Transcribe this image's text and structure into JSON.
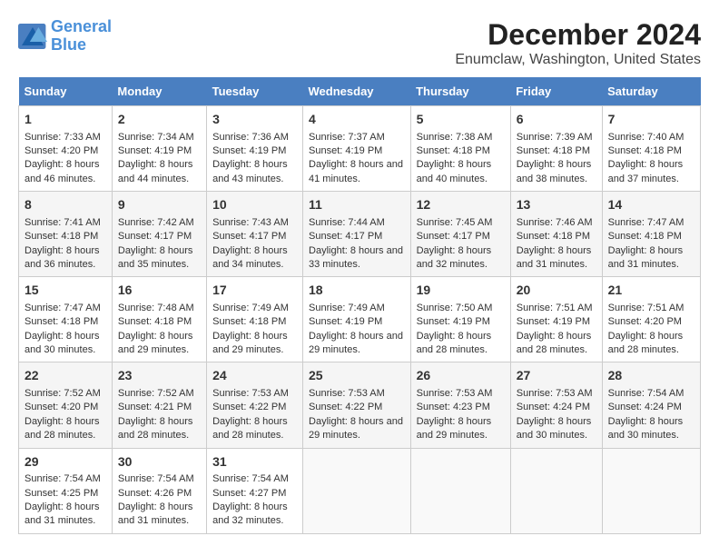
{
  "logo": {
    "line1": "General",
    "line2": "Blue"
  },
  "title": "December 2024",
  "subtitle": "Enumclaw, Washington, United States",
  "days_of_week": [
    "Sunday",
    "Monday",
    "Tuesday",
    "Wednesday",
    "Thursday",
    "Friday",
    "Saturday"
  ],
  "weeks": [
    [
      {
        "day": "1",
        "sunrise": "7:33 AM",
        "sunset": "4:20 PM",
        "daylight": "8 hours and 46 minutes."
      },
      {
        "day": "2",
        "sunrise": "7:34 AM",
        "sunset": "4:19 PM",
        "daylight": "8 hours and 44 minutes."
      },
      {
        "day": "3",
        "sunrise": "7:36 AM",
        "sunset": "4:19 PM",
        "daylight": "8 hours and 43 minutes."
      },
      {
        "day": "4",
        "sunrise": "7:37 AM",
        "sunset": "4:19 PM",
        "daylight": "8 hours and 41 minutes."
      },
      {
        "day": "5",
        "sunrise": "7:38 AM",
        "sunset": "4:18 PM",
        "daylight": "8 hours and 40 minutes."
      },
      {
        "day": "6",
        "sunrise": "7:39 AM",
        "sunset": "4:18 PM",
        "daylight": "8 hours and 38 minutes."
      },
      {
        "day": "7",
        "sunrise": "7:40 AM",
        "sunset": "4:18 PM",
        "daylight": "8 hours and 37 minutes."
      }
    ],
    [
      {
        "day": "8",
        "sunrise": "7:41 AM",
        "sunset": "4:18 PM",
        "daylight": "8 hours and 36 minutes."
      },
      {
        "day": "9",
        "sunrise": "7:42 AM",
        "sunset": "4:17 PM",
        "daylight": "8 hours and 35 minutes."
      },
      {
        "day": "10",
        "sunrise": "7:43 AM",
        "sunset": "4:17 PM",
        "daylight": "8 hours and 34 minutes."
      },
      {
        "day": "11",
        "sunrise": "7:44 AM",
        "sunset": "4:17 PM",
        "daylight": "8 hours and 33 minutes."
      },
      {
        "day": "12",
        "sunrise": "7:45 AM",
        "sunset": "4:17 PM",
        "daylight": "8 hours and 32 minutes."
      },
      {
        "day": "13",
        "sunrise": "7:46 AM",
        "sunset": "4:18 PM",
        "daylight": "8 hours and 31 minutes."
      },
      {
        "day": "14",
        "sunrise": "7:47 AM",
        "sunset": "4:18 PM",
        "daylight": "8 hours and 31 minutes."
      }
    ],
    [
      {
        "day": "15",
        "sunrise": "7:47 AM",
        "sunset": "4:18 PM",
        "daylight": "8 hours and 30 minutes."
      },
      {
        "day": "16",
        "sunrise": "7:48 AM",
        "sunset": "4:18 PM",
        "daylight": "8 hours and 29 minutes."
      },
      {
        "day": "17",
        "sunrise": "7:49 AM",
        "sunset": "4:18 PM",
        "daylight": "8 hours and 29 minutes."
      },
      {
        "day": "18",
        "sunrise": "7:49 AM",
        "sunset": "4:19 PM",
        "daylight": "8 hours and 29 minutes."
      },
      {
        "day": "19",
        "sunrise": "7:50 AM",
        "sunset": "4:19 PM",
        "daylight": "8 hours and 28 minutes."
      },
      {
        "day": "20",
        "sunrise": "7:51 AM",
        "sunset": "4:19 PM",
        "daylight": "8 hours and 28 minutes."
      },
      {
        "day": "21",
        "sunrise": "7:51 AM",
        "sunset": "4:20 PM",
        "daylight": "8 hours and 28 minutes."
      }
    ],
    [
      {
        "day": "22",
        "sunrise": "7:52 AM",
        "sunset": "4:20 PM",
        "daylight": "8 hours and 28 minutes."
      },
      {
        "day": "23",
        "sunrise": "7:52 AM",
        "sunset": "4:21 PM",
        "daylight": "8 hours and 28 minutes."
      },
      {
        "day": "24",
        "sunrise": "7:53 AM",
        "sunset": "4:22 PM",
        "daylight": "8 hours and 28 minutes."
      },
      {
        "day": "25",
        "sunrise": "7:53 AM",
        "sunset": "4:22 PM",
        "daylight": "8 hours and 29 minutes."
      },
      {
        "day": "26",
        "sunrise": "7:53 AM",
        "sunset": "4:23 PM",
        "daylight": "8 hours and 29 minutes."
      },
      {
        "day": "27",
        "sunrise": "7:53 AM",
        "sunset": "4:24 PM",
        "daylight": "8 hours and 30 minutes."
      },
      {
        "day": "28",
        "sunrise": "7:54 AM",
        "sunset": "4:24 PM",
        "daylight": "8 hours and 30 minutes."
      }
    ],
    [
      {
        "day": "29",
        "sunrise": "7:54 AM",
        "sunset": "4:25 PM",
        "daylight": "8 hours and 31 minutes."
      },
      {
        "day": "30",
        "sunrise": "7:54 AM",
        "sunset": "4:26 PM",
        "daylight": "8 hours and 31 minutes."
      },
      {
        "day": "31",
        "sunrise": "7:54 AM",
        "sunset": "4:27 PM",
        "daylight": "8 hours and 32 minutes."
      },
      null,
      null,
      null,
      null
    ]
  ],
  "labels": {
    "sunrise": "Sunrise:",
    "sunset": "Sunset:",
    "daylight": "Daylight:"
  }
}
